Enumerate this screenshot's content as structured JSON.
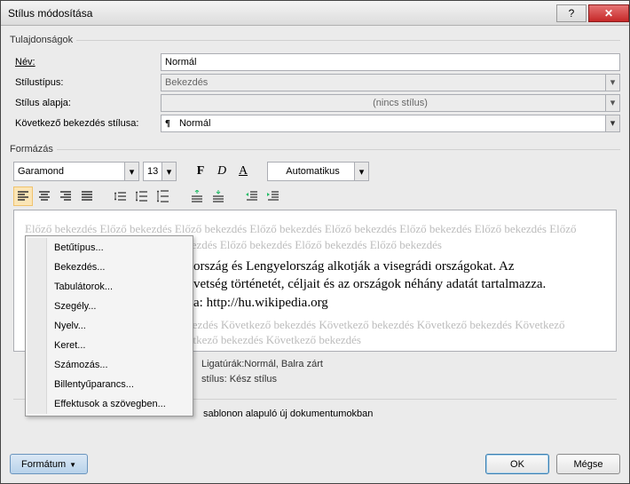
{
  "window": {
    "title": "Stílus módosítása"
  },
  "properties": {
    "legend": "Tulajdonságok",
    "name_label": "Név:",
    "name_value": "Normál",
    "type_label": "Stílustípus:",
    "type_value": "Bekezdés",
    "based_label": "Stílus alapja:",
    "based_value": "(nincs stílus)",
    "next_label": "Következő bekezdés stílusa:",
    "next_value": "Normál"
  },
  "formatting": {
    "legend": "Formázás",
    "font": "Garamond",
    "size": "13",
    "auto": "Automatikus"
  },
  "preview": {
    "ghost_prev": "Előző bekezdés Előző bekezdés Előző bekezdés Előző bekezdés Előző bekezdés Előző bekezdés Előző bekezdés Előző bekezdés Előző bekezdés Előző bekezdés Előző bekezdés Előző bekezdés Előző bekezdés",
    "sample_line1": "Magyarország, Szlovákia, Csehország és Lengyelország alkotják a visegrádi országokat. Az",
    "sample_line2": "vetség történetét, céljait és az országok néhány adatát tartalmazza.",
    "sample_line3": "a: http://hu.wikipedia.org",
    "ghost_next": "Következő bekezdés Következő bekezdés Következő bekezdés Következő bekezdés Következő bekezdés Következő bekezdés Következő bekezdés Következő bekezdés Következő bekezdés"
  },
  "summary": {
    "line1": "Ligatúrák:Normál, Balra zárt",
    "line2": "stílus: Kész stílus"
  },
  "checkbox": {
    "add_template": "sablonon alapuló új dokumentumokban"
  },
  "footer": {
    "format": "Formátum",
    "ok": "OK",
    "cancel": "Mégse"
  },
  "menu": {
    "items": [
      "Betűtípus...",
      "Bekezdés...",
      "Tabulátorok...",
      "Szegély...",
      "Nyelv...",
      "Keret...",
      "Számozás...",
      "Billentyűparancs...",
      "Effektusok a szövegben..."
    ]
  }
}
